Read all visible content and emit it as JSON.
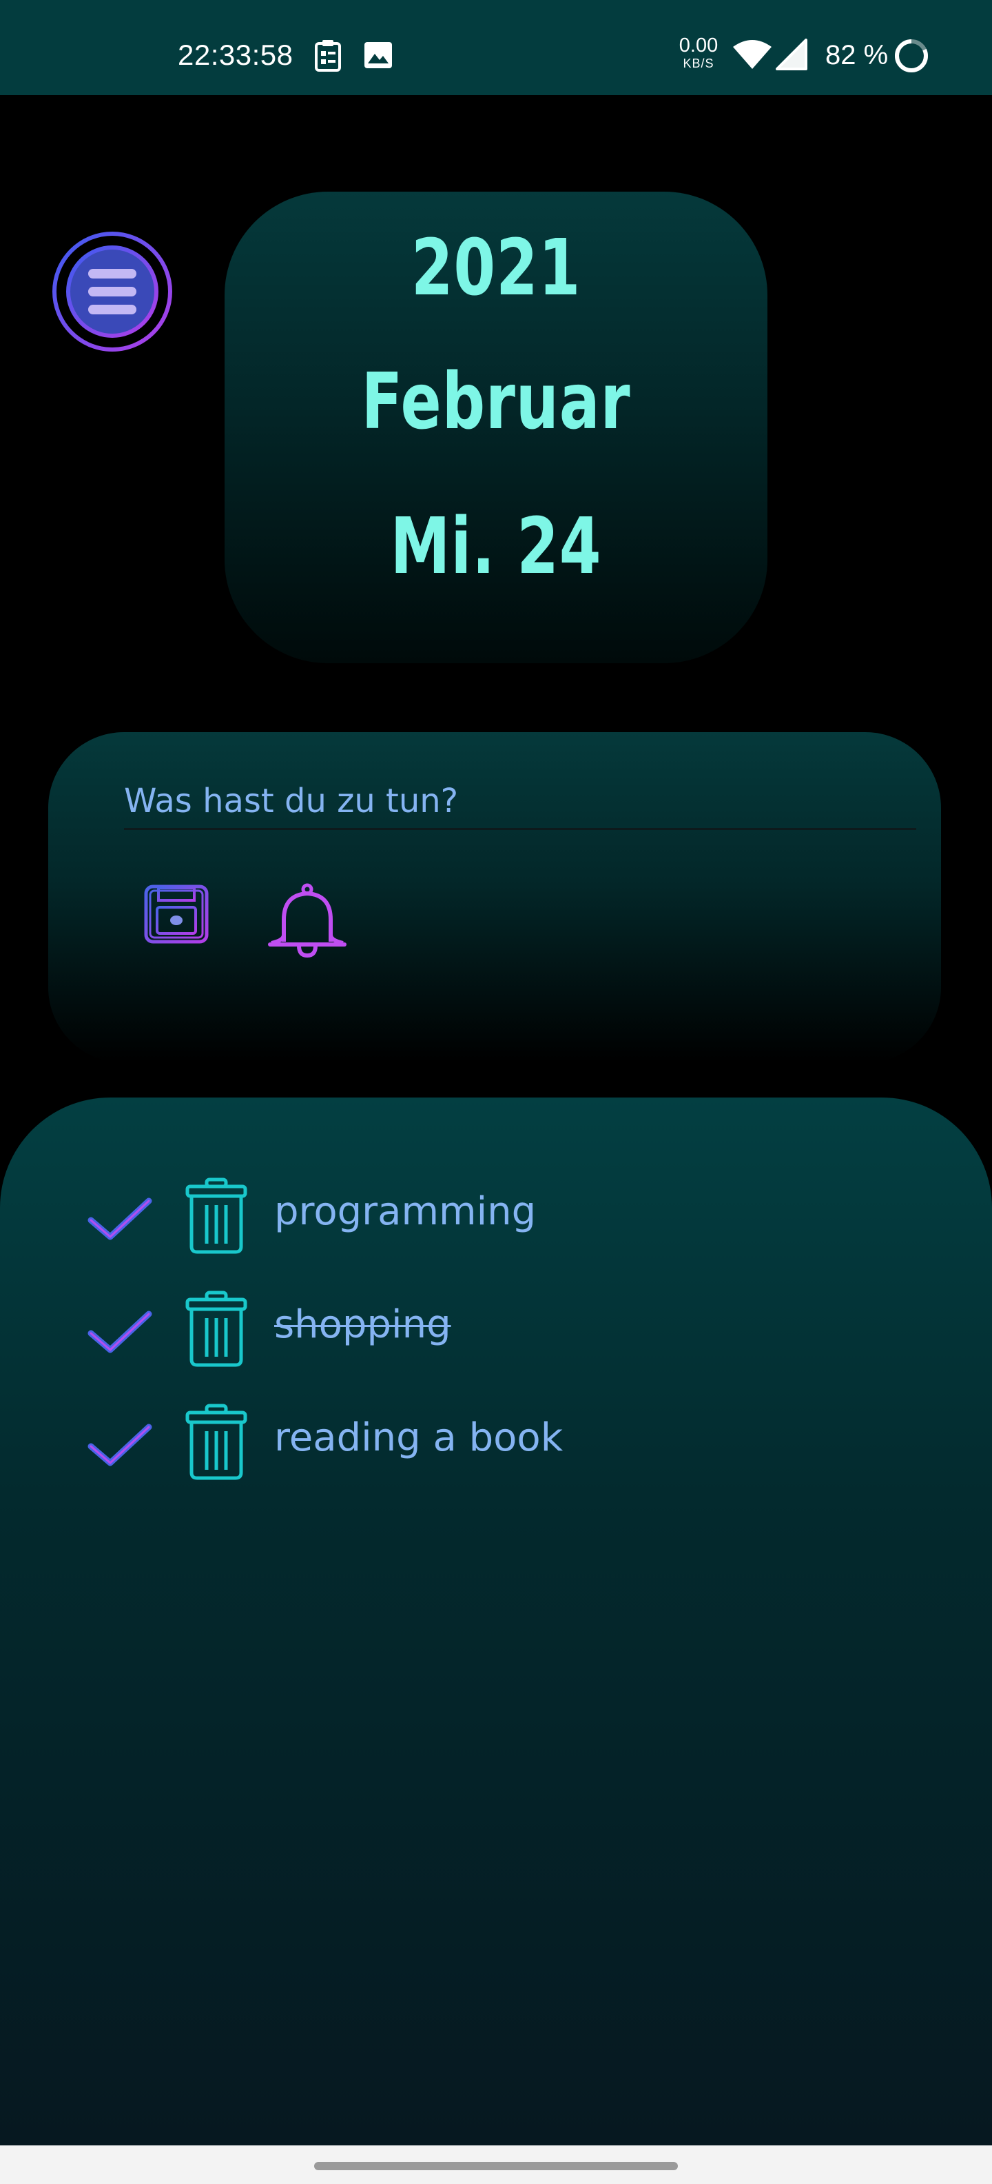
{
  "status_bar": {
    "time": "22:33:58",
    "net_speed_value": "0.00",
    "net_speed_unit": "KB/S",
    "battery_percent": "82 %",
    "icons": [
      "clipboard-icon",
      "image-icon",
      "wifi-icon",
      "cellular-signal-icon",
      "battery-ring-icon"
    ]
  },
  "header": {
    "menu_icon": "menu-icon"
  },
  "date_card": {
    "year": "2021",
    "month": "Februar",
    "day": "Mi. 24"
  },
  "input_card": {
    "placeholder": "Was hast du zu tun?",
    "value": "",
    "save_icon": "floppy-disk-icon",
    "reminder_icon": "bell-icon"
  },
  "tasks": [
    {
      "label": "programming",
      "done": false
    },
    {
      "label": "shopping",
      "done": true
    },
    {
      "label": "reading a book",
      "done": false
    }
  ],
  "colors": {
    "status_bar_bg": "#033c3e",
    "date_text": "#7ef6e6",
    "task_text": "#85b4f2",
    "accent_purple": "#b44df0",
    "accent_blue": "#4a63e8",
    "trash_teal": "#19c8cc"
  }
}
